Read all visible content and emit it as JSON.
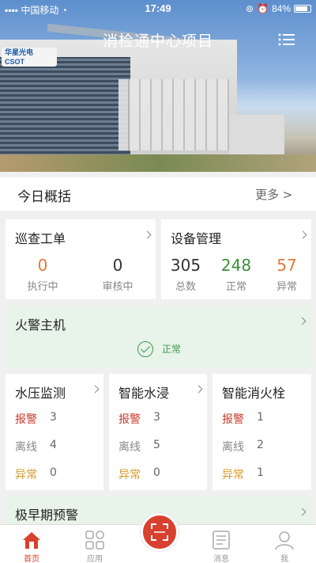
{
  "status_bar": {
    "carrier": "中国移动",
    "time": "17:49",
    "battery": "84%"
  },
  "header": {
    "title": "消检通中心项目"
  },
  "hero": {
    "brand": "华星光电",
    "brand_sub": "CSOT"
  },
  "overview": {
    "title": "今日概括",
    "more": "更多 >"
  },
  "inspection": {
    "title": "巡查工单",
    "items": [
      {
        "value": "0",
        "label": "执行中",
        "color": "#e07b3a"
      },
      {
        "value": "0",
        "label": "审核中",
        "color": "#333333"
      }
    ]
  },
  "equipment": {
    "title": "设备管理",
    "items": [
      {
        "value": "305",
        "label": "总数",
        "color": "#333333"
      },
      {
        "value": "248",
        "label": "正常",
        "color": "#3c8f3a"
      },
      {
        "value": "57",
        "label": "异常",
        "color": "#e07b3a"
      }
    ]
  },
  "fire_host": {
    "title": "火警主机",
    "status": "正常"
  },
  "modules": [
    {
      "title": "水压监测",
      "rows": [
        {
          "label": "报警",
          "value": "3"
        },
        {
          "label": "离线",
          "value": "4"
        },
        {
          "label": "异常",
          "value": "0"
        }
      ]
    },
    {
      "title": "智能水浸",
      "rows": [
        {
          "label": "报警",
          "value": "3"
        },
        {
          "label": "离线",
          "value": "5"
        },
        {
          "label": "异常",
          "value": "0"
        }
      ]
    },
    {
      "title": "智能消火栓",
      "rows": [
        {
          "label": "报警",
          "value": "1"
        },
        {
          "label": "离线",
          "value": "2"
        },
        {
          "label": "异常",
          "value": "1"
        }
      ]
    }
  ],
  "early_warning": {
    "title": "极早期预警"
  },
  "tabbar": [
    {
      "label": "首页",
      "icon": "home-icon",
      "active": true
    },
    {
      "label": "应用",
      "icon": "apps-icon",
      "active": false
    },
    {
      "label": "",
      "icon": "scan-icon",
      "active": false
    },
    {
      "label": "消息",
      "icon": "message-icon",
      "active": false
    },
    {
      "label": "我",
      "icon": "user-icon",
      "active": false
    }
  ],
  "colors": {
    "accent": "#d8402f",
    "alarm": "#c9392c",
    "offline": "#888888",
    "abnormal": "#d99a2b",
    "ok": "#3c9a4f"
  }
}
